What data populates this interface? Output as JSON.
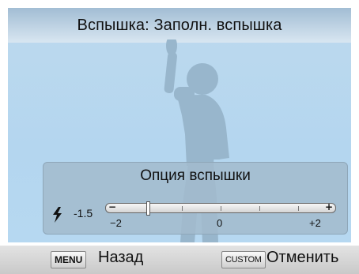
{
  "header": {
    "title": "Вспышка: Заполн. вспышка"
  },
  "panel": {
    "title": "Опция вспышки",
    "value": "-1.5",
    "slider": {
      "minus_symbol": "−",
      "plus_symbol": "+",
      "min_label": "−2",
      "mid_label": "0",
      "max_label": "+2",
      "current": -1.5,
      "min": -2,
      "max": 2
    }
  },
  "footer": {
    "menu_key": "MENU",
    "menu_label": "Назад",
    "custom_key": "CUSTOM",
    "custom_label": "Отменить"
  },
  "icons": {
    "flash": "flash-icon"
  },
  "colors": {
    "viewfinder": "#b4d6ef",
    "panel": "#a2bbcc",
    "bar": "#d6d6d6"
  }
}
